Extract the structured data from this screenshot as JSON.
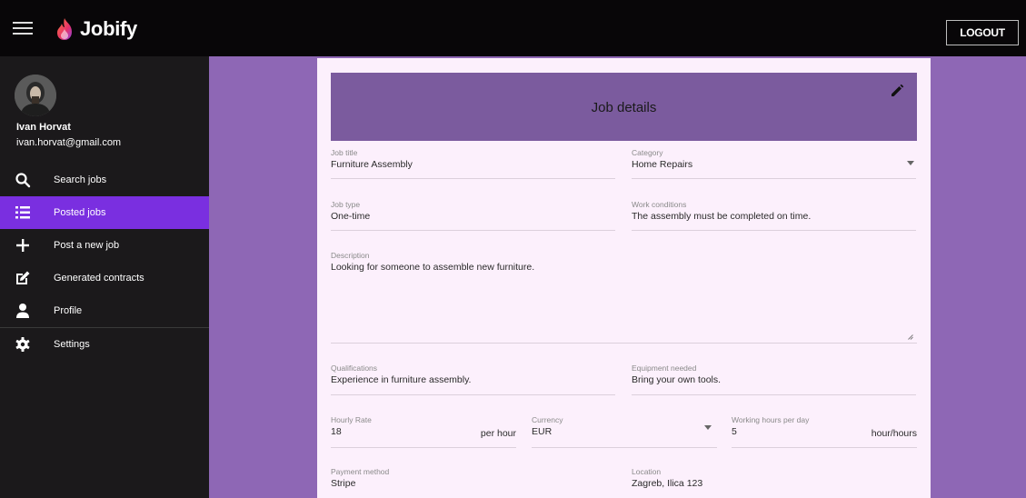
{
  "app": {
    "name": "Jobify",
    "logout_label": "LOGOUT"
  },
  "user": {
    "name": "Ivan Horvat",
    "email": "ivan.horvat@gmail.com"
  },
  "sidebar": {
    "items": [
      {
        "label": "Search jobs",
        "icon": "search-icon",
        "active": false
      },
      {
        "label": "Posted jobs",
        "icon": "list-icon",
        "active": true
      },
      {
        "label": "Post a new job",
        "icon": "plus-icon",
        "active": false
      },
      {
        "label": "Generated contracts",
        "icon": "edit-document-icon",
        "active": false
      },
      {
        "label": "Profile",
        "icon": "person-icon",
        "active": false
      },
      {
        "label": "Settings",
        "icon": "gear-icon",
        "active": false
      }
    ]
  },
  "card": {
    "title": "Job details",
    "fields": {
      "job_title": {
        "label": "Job title",
        "value": "Furniture Assembly"
      },
      "category": {
        "label": "Category",
        "value": "Home Repairs"
      },
      "job_type": {
        "label": "Job type",
        "value": "One-time"
      },
      "work_conditions": {
        "label": "Work conditions",
        "value": "The assembly must be completed on time."
      },
      "description": {
        "label": "Description",
        "value": "Looking for someone to assemble new furniture."
      },
      "qualifications": {
        "label": "Qualifications",
        "value": "Experience in furniture assembly."
      },
      "equipment": {
        "label": "Equipment needed",
        "value": "Bring your own tools."
      },
      "hourly_rate": {
        "label": "Hourly Rate",
        "value": "18",
        "suffix": "per hour"
      },
      "currency": {
        "label": "Currency",
        "value": "EUR"
      },
      "working_hours": {
        "label": "Working hours per day",
        "value": "5",
        "suffix": "hour/hours"
      },
      "payment_method": {
        "label": "Payment method",
        "value": "Stripe"
      },
      "location": {
        "label": "Location",
        "value": "Zagreb, Ilica 123"
      }
    }
  },
  "colors": {
    "background": "#8e67b5",
    "topbar": "#080608",
    "sidebar": "#1b191b",
    "active_item": "#7a2fe0",
    "card": "#fcf0fc",
    "card_header": "#7b5b9e"
  }
}
